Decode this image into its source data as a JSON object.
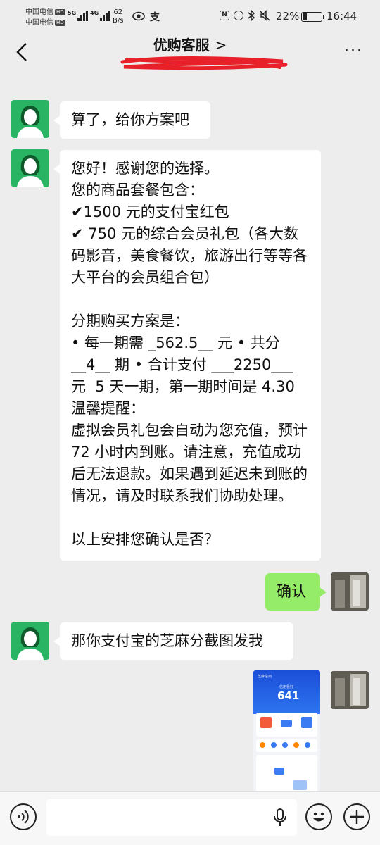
{
  "status_bar": {
    "carrier_1": "中国电信",
    "carrier_2": "中国电信",
    "hd_badge": "HD",
    "network_1": "5G",
    "network_2": "4G",
    "net_speed_value": "62",
    "net_speed_unit": "B/s",
    "battery_percent": "22%",
    "battery_level": 0.22,
    "time": "16:44",
    "icons": [
      "signal-icon",
      "eye-icon",
      "alipay-icon",
      "nfc-icon",
      "alarm-icon",
      "bluetooth-icon",
      "mute-icon",
      "battery-icon"
    ]
  },
  "header": {
    "title": "优购客服",
    "title_chevron": ">",
    "more_label": "···"
  },
  "messages": [
    {
      "sender": "agent",
      "text": "算了，给你方案吧"
    },
    {
      "sender": "agent",
      "text": "您好！感谢您的选择。\n您的商品套餐包含：\n✔1500 元的支付宝红包\n✔ 750 元的综合会员礼包（各大数码影音，美食餐饮，旅游出行等等各大平台的会员组合包）\n\n分期购买方案是：\n• 每一期需 _562.5__ 元 • 共分 __4__ 期 • 合计支付 ___2250___ 元  5 天一期，第一期时间是 4.30\n温馨提醒：\n虚拟会员礼包会自动为您充值，预计 72 小时内到账。请注意，充值成功后无法退款。如果遇到延迟未到账的情况，请及时联系我们协助处理。\n\n以上安排您确认是否？"
    },
    {
      "sender": "user",
      "text": "确认"
    },
    {
      "sender": "agent",
      "text": "那你支付宝的芝麻分截图发我"
    }
  ],
  "screenshot_message": {
    "app_title": "芝麻信用",
    "score_label": "信用极好",
    "score": "641"
  },
  "colors": {
    "chat_bg": "#ededed",
    "agent_avatar": "#28b463",
    "user_bubble": "#95ec69",
    "redaction": "#e8202a"
  }
}
